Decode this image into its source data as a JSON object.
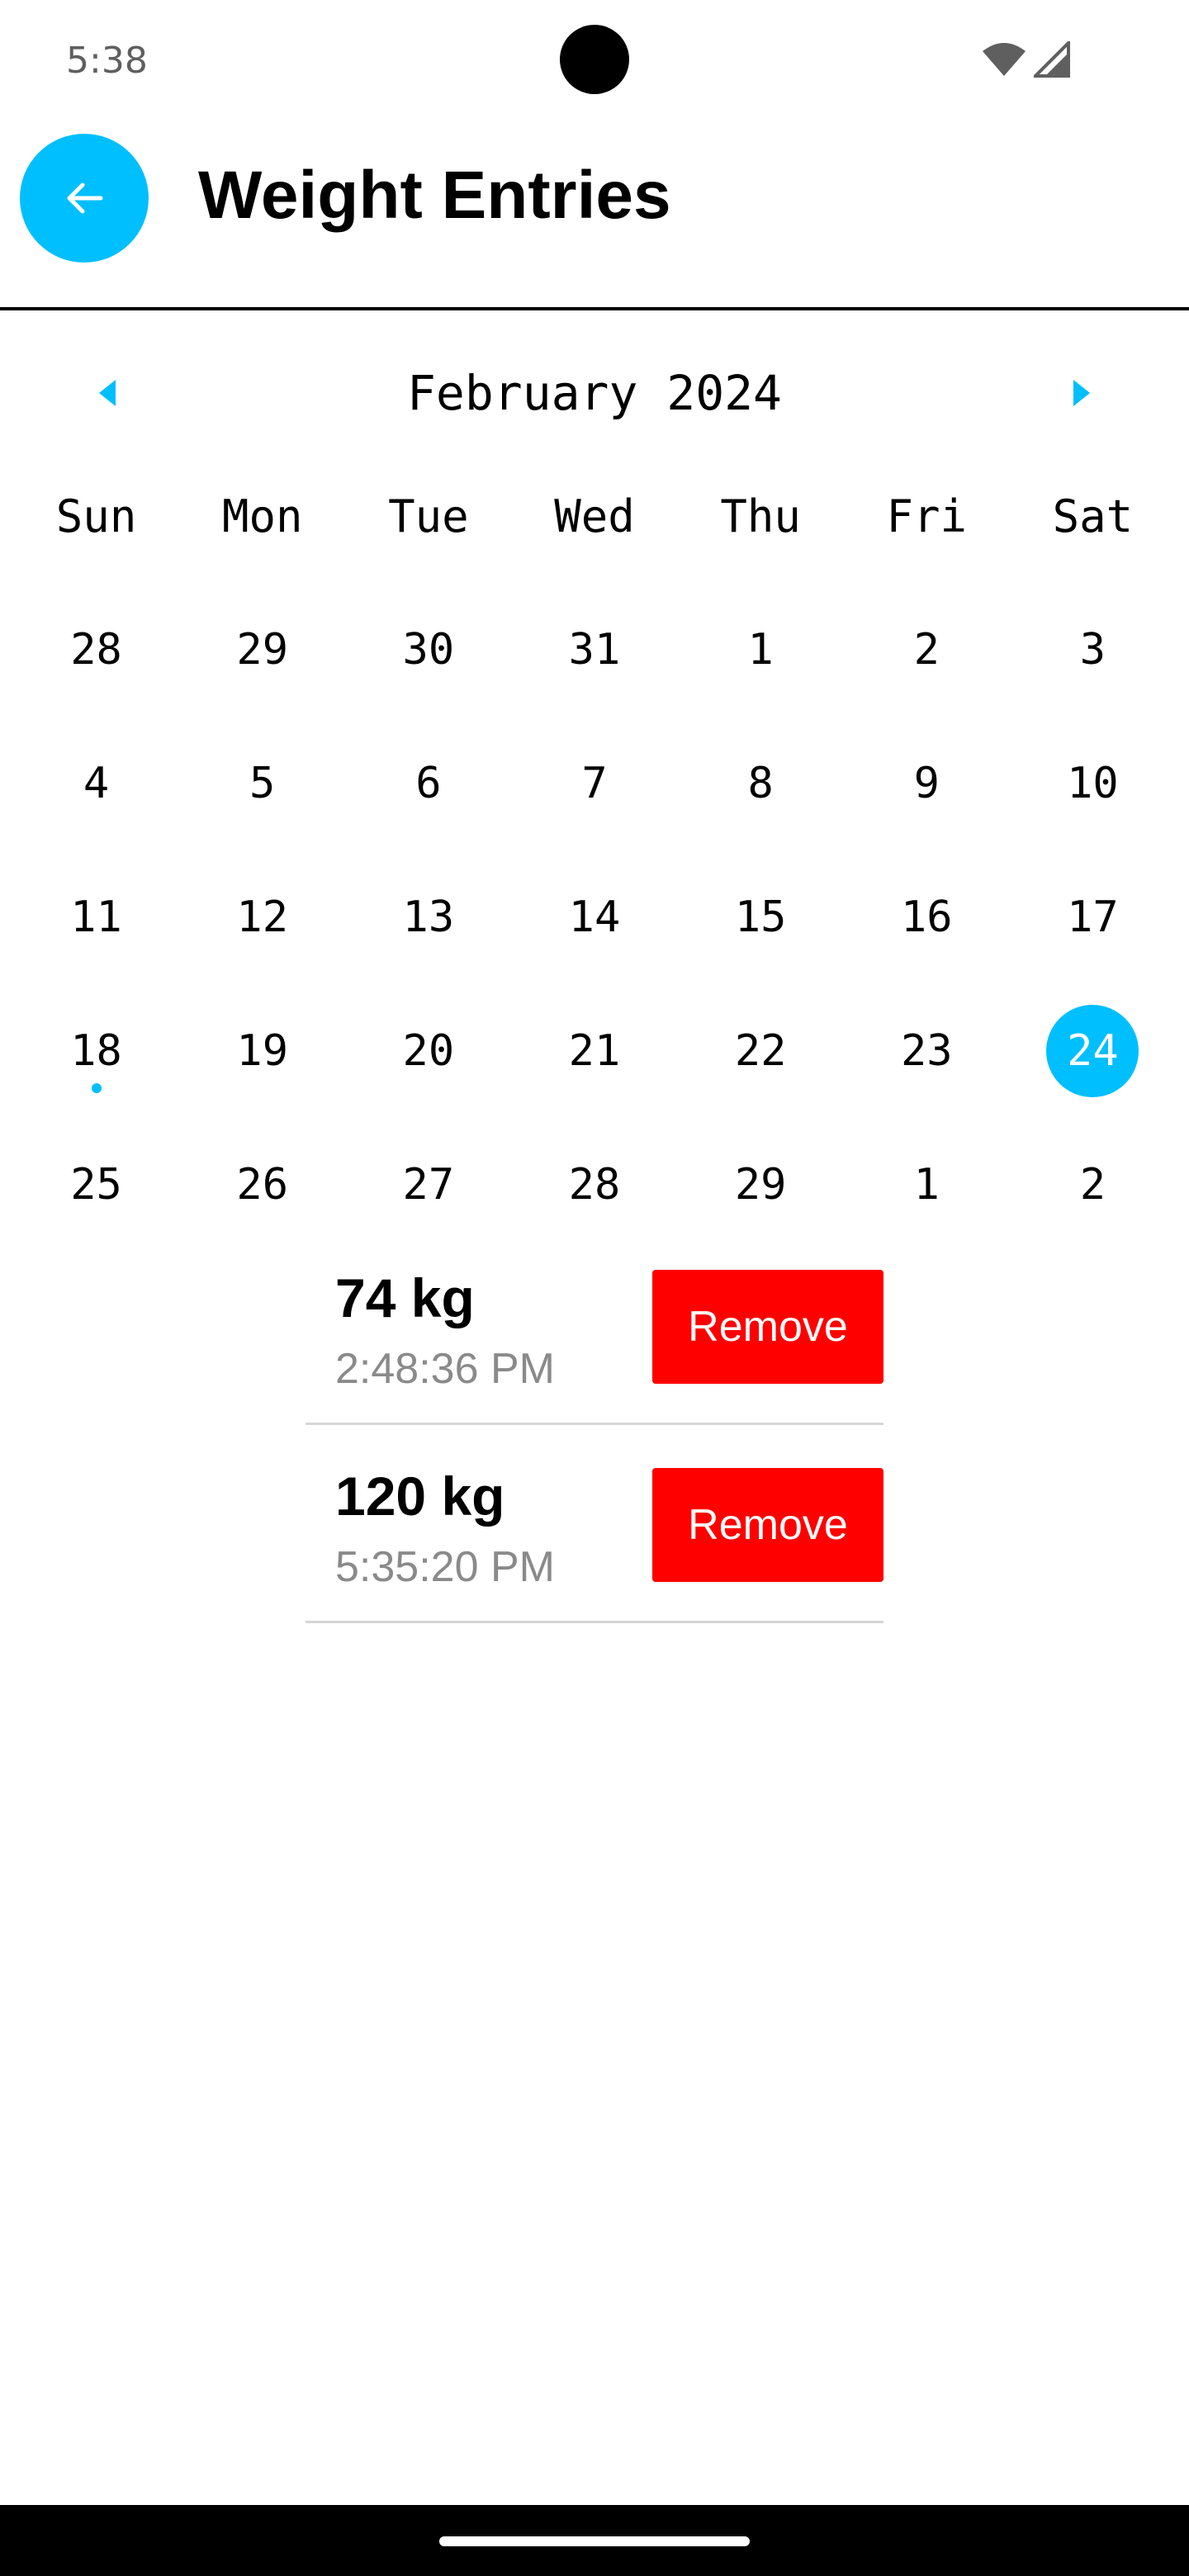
{
  "status_bar": {
    "time": "5:38",
    "icons": [
      "wifi-icon",
      "signal-icon"
    ]
  },
  "app_bar": {
    "title": "Weight Entries",
    "back_icon": "arrow-left-icon"
  },
  "calendar": {
    "month_label": "February 2024",
    "prev_icon": "caret-left-icon",
    "next_icon": "caret-right-icon",
    "weekdays": [
      "Sun",
      "Mon",
      "Tue",
      "Wed",
      "Thu",
      "Fri",
      "Sat"
    ],
    "weeks": [
      [
        "28",
        "29",
        "30",
        "31",
        "1",
        "2",
        "3"
      ],
      [
        "4",
        "5",
        "6",
        "7",
        "8",
        "9",
        "10"
      ],
      [
        "11",
        "12",
        "13",
        "14",
        "15",
        "16",
        "17"
      ],
      [
        "18",
        "19",
        "20",
        "21",
        "22",
        "23",
        "24"
      ],
      [
        "25",
        "26",
        "27",
        "28",
        "29",
        "1",
        "2"
      ]
    ],
    "selected_day": "24",
    "days_with_entries": [
      "18"
    ]
  },
  "entries": [
    {
      "weight": "74 kg",
      "time": "2:48:36 PM",
      "remove_label": "Remove"
    },
    {
      "weight": "120 kg",
      "time": "5:35:20 PM",
      "remove_label": "Remove"
    }
  ],
  "colors": {
    "accent": "#00bfff",
    "remove": "#ff0000",
    "muted_text": "#8a8a8a"
  }
}
